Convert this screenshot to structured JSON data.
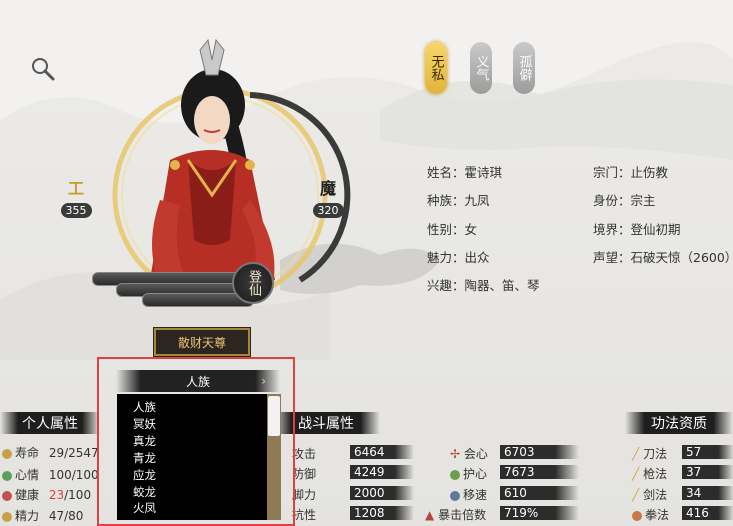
{
  "header": {
    "search_icon": "search-icon"
  },
  "character": {
    "power_left": {
      "glyph": "工",
      "value": "355"
    },
    "power_right": {
      "glyph": "魔",
      "value": "320"
    },
    "realm_badge": "登仙",
    "title_button": "散财天尊"
  },
  "virtues": [
    {
      "label": "无私",
      "active": true
    },
    {
      "label": "义气",
      "active": false
    },
    {
      "label": "孤僻",
      "active": false
    }
  ],
  "info": {
    "name": "姓名：霍诗琪",
    "sect": "宗门：止伤教",
    "race": "种族：九凤",
    "identity": "身份：宗主",
    "gender": "性别：女",
    "realm": "境界：登仙初期",
    "charm": "魅力：出众",
    "fame": "声望：石破天惊（2600）",
    "hobby": "兴趣：陶器、笛、琴"
  },
  "sections": {
    "personal": "个人属性",
    "combat": "战斗属性",
    "skills": "功法资质"
  },
  "personal_stats": [
    {
      "label": "寿命",
      "value": "29/2547"
    },
    {
      "label": "心情",
      "value": "100/100"
    },
    {
      "label": "健康",
      "value_red": "23",
      "value_rest": "/100"
    },
    {
      "label": "精力",
      "value": "47/80"
    }
  ],
  "combat_stats_left": [
    {
      "label": "攻击",
      "value": "6464"
    },
    {
      "label": "防御",
      "value": "4249"
    },
    {
      "label": "脚力",
      "value": "2000"
    },
    {
      "label": "抗性",
      "value": "1208"
    }
  ],
  "combat_stats_right": [
    {
      "label": "会心",
      "value": "6703"
    },
    {
      "label": "护心",
      "value": "7673"
    },
    {
      "label": "移速",
      "value": "610"
    },
    {
      "label": "暴击倍数",
      "value": "719%"
    }
  ],
  "skill_stats": [
    {
      "label": "刀法",
      "value": "57"
    },
    {
      "label": "枪法",
      "value": "37"
    },
    {
      "label": "剑法",
      "value": "34"
    },
    {
      "label": "拳法",
      "value": "416"
    }
  ],
  "dropdown": {
    "selected": "人族",
    "options": [
      "人族",
      "冥妖",
      "真龙",
      "青龙",
      "应龙",
      "蛟龙",
      "火凤"
    ]
  },
  "colors": {
    "accent_gold": "#e3b23b",
    "danger": "#e04040",
    "panel_dark": "#2c2c2c"
  }
}
